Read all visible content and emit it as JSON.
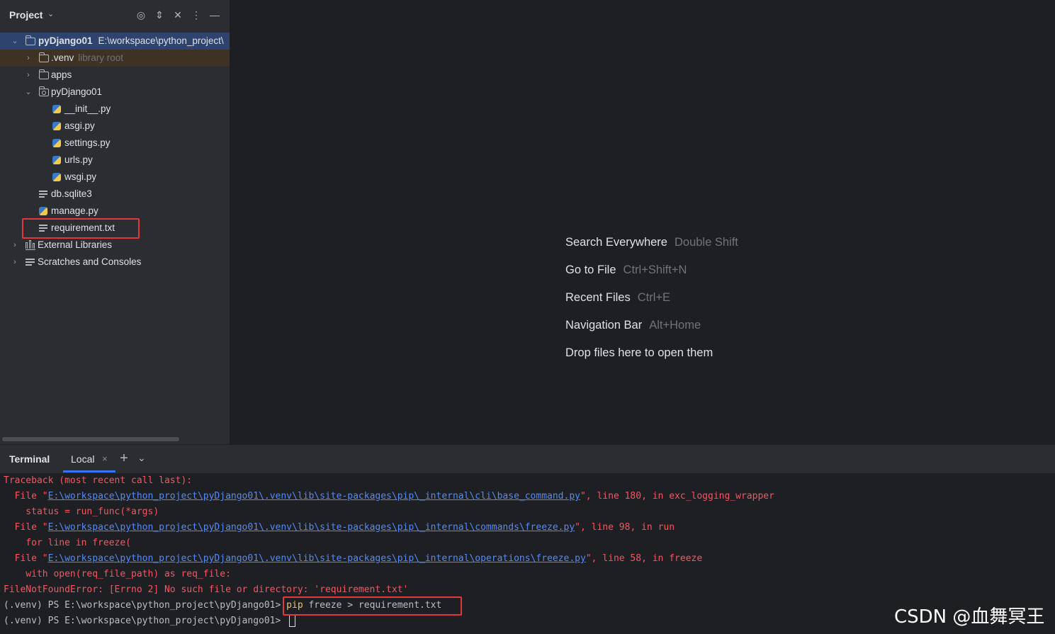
{
  "project_panel": {
    "title": "Project",
    "header_icons": [
      "target-icon",
      "expand-collapse-icon",
      "collapse-all-icon",
      "more-options-icon",
      "minimize-icon"
    ],
    "tree": [
      {
        "label": "pyDjango01",
        "hint": "E:\\workspace\\python_project\\",
        "type": "folder",
        "expanded": true,
        "selected": true
      },
      {
        "label": ".venv",
        "hint": "library root",
        "type": "folder",
        "expanded": false,
        "excluded": true
      },
      {
        "label": "apps",
        "type": "folder",
        "expanded": false
      },
      {
        "label": "pyDjango01",
        "type": "package",
        "expanded": true
      },
      {
        "label": "__init__.py",
        "type": "python"
      },
      {
        "label": "asgi.py",
        "type": "python"
      },
      {
        "label": "settings.py",
        "type": "python"
      },
      {
        "label": "urls.py",
        "type": "python"
      },
      {
        "label": "wsgi.py",
        "type": "python"
      },
      {
        "label": "db.sqlite3",
        "type": "text"
      },
      {
        "label": "manage.py",
        "type": "python"
      },
      {
        "label": "requirement.txt",
        "type": "text",
        "highlighted": true
      },
      {
        "label": "External Libraries",
        "type": "library",
        "expanded": false
      },
      {
        "label": "Scratches and Consoles",
        "type": "scratches",
        "expanded": false
      }
    ]
  },
  "editor": {
    "tips": [
      {
        "action": "Search Everywhere",
        "shortcut": "Double Shift"
      },
      {
        "action": "Go to File",
        "shortcut": "Ctrl+Shift+N"
      },
      {
        "action": "Recent Files",
        "shortcut": "Ctrl+E"
      },
      {
        "action": "Navigation Bar",
        "shortcut": "Alt+Home"
      },
      {
        "action": "Drop files here to open them",
        "shortcut": ""
      }
    ]
  },
  "terminal": {
    "title": "Terminal",
    "tab": "Local",
    "tab_close": "×",
    "new_tab": "+",
    "dropdown": "⌄",
    "lines": {
      "l1": "Traceback (most recent call last):",
      "l2_pre": "  File \"",
      "l2_link": "E:\\workspace\\python_project\\pyDjango01\\.venv\\lib\\site-packages\\pip\\_internal\\cli\\base_command.py",
      "l2_post": "\", line 180, in exc_logging_wrapper",
      "l3": "    status = run_func(*args)",
      "l4_pre": "  File \"",
      "l4_link": "E:\\workspace\\python_project\\pyDjango01\\.venv\\lib\\site-packages\\pip\\_internal\\commands\\freeze.py",
      "l4_post": "\", line 98, in run",
      "l5": "    for line in freeze(",
      "l6_pre": "  File \"",
      "l6_link": "E:\\workspace\\python_project\\pyDjango01\\.venv\\lib\\site-packages\\pip\\_internal\\operations\\freeze.py",
      "l6_post": "\", line 58, in freeze",
      "l7": "    with open(req_file_path) as req_file:",
      "l8": "FileNotFoundError: [Errno 2] No such file or directory: 'requirement.txt'",
      "prompt": "(.venv) PS E:\\workspace\\python_project\\pyDjango01> ",
      "cmd_pip": "pip",
      "cmd_rest": " freeze > requirement.txt"
    }
  },
  "watermark": "CSDN @血舞冥王",
  "colors": {
    "selection": "#2e436e",
    "error_text": "#f75464",
    "link": "#548af7",
    "highlight_box": "#e0383b",
    "tab_accent": "#3574f0"
  }
}
